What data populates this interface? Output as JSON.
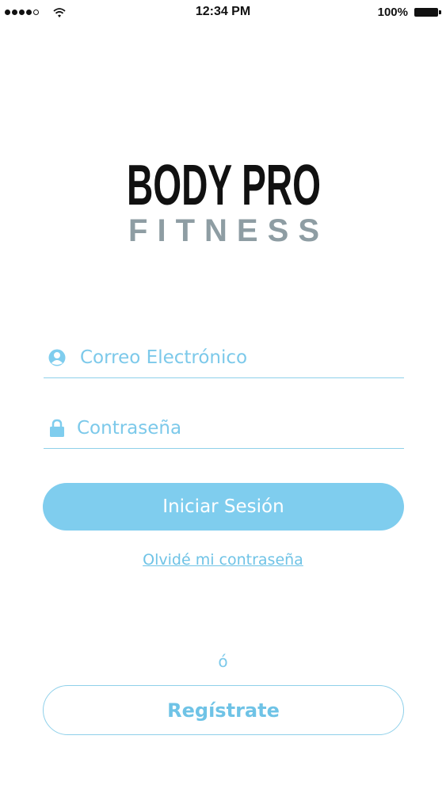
{
  "status_bar": {
    "time": "12:34 PM",
    "battery": "100%",
    "signal_icon": "signal-dots-icon",
    "wifi_icon": "wifi-icon",
    "battery_icon": "battery-icon"
  },
  "logo": {
    "title": "BODY PRO",
    "subtitle": "FITNESS",
    "title_color": "#111111",
    "subtitle_color": "#8e9da3"
  },
  "login_form": {
    "email_placeholder": "Correo Electrónico",
    "email_value": "",
    "email_icon": "user-icon",
    "password_placeholder": "Contraseña",
    "password_value": "",
    "password_icon": "lock-icon",
    "submit_label": "Iniciar Sesión",
    "forgot_label": "Olvidé mi contraseña"
  },
  "separator": "ó",
  "register_label": "Regístrate",
  "colors": {
    "accent": "#7fcdee",
    "accent_text": "#6fc3e6"
  }
}
